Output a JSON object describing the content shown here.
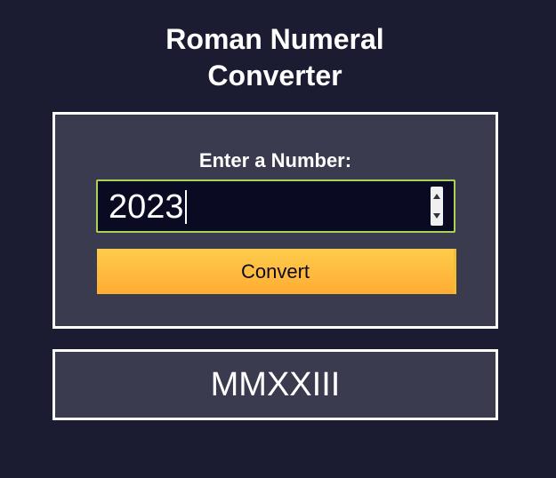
{
  "page": {
    "title_line1": "Roman Numeral",
    "title_line2": "Converter"
  },
  "form": {
    "label": "Enter a Number:",
    "input_value": "2023",
    "button_label": "Convert"
  },
  "output": {
    "text": "MMXXIII"
  },
  "colors": {
    "background": "#1b1b32",
    "panel": "#3b3b4f",
    "input_background": "#0a0a23",
    "input_border": "#acd157",
    "button_gradient_top": "#fecc4c",
    "button_gradient_bottom": "#ffac33",
    "text": "#ffffff"
  },
  "icons": {
    "spinner_up": "chevron-up-icon",
    "spinner_down": "chevron-down-icon"
  }
}
